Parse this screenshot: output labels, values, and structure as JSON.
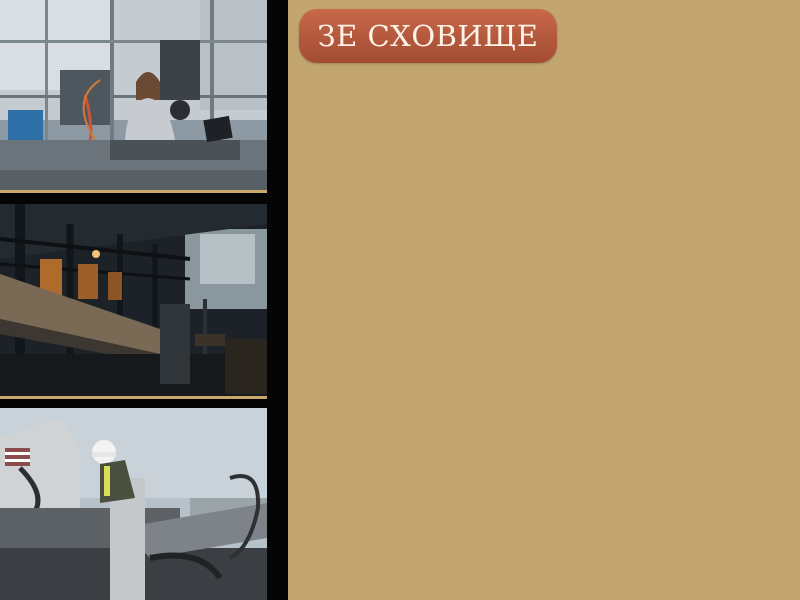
{
  "header": {
    "storage_button_label": "ЗЕ СХОВИЩЕ"
  },
  "gallery": {
    "images": [
      {
        "name": "lab-engineer-photo",
        "alt_icon": "photo-lab-engineer"
      },
      {
        "name": "steel-mill-photo",
        "alt_icon": "photo-steel-mill"
      },
      {
        "name": "drilling-rig-worker-photo",
        "alt_icon": "photo-drilling-rig"
      }
    ]
  },
  "colors": {
    "background": "#c3a56f",
    "strip": "#050505",
    "button": "#b7593d",
    "gold_rule": "#c9a86a"
  }
}
